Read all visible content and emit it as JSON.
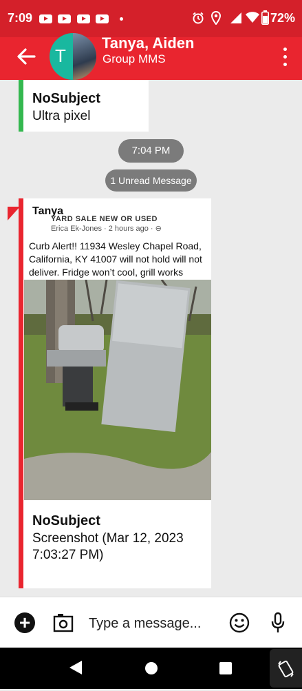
{
  "status_bar": {
    "time": "7:09",
    "battery": "72%",
    "icons": [
      "youtube-icon",
      "youtube-icon",
      "youtube-icon",
      "youtube-icon",
      "dot-icon",
      "alarm-icon",
      "location-icon",
      "signal-icon",
      "wifi-icon",
      "battery-icon"
    ]
  },
  "header": {
    "title": "Tanya, Aiden",
    "subtitle": "Group MMS",
    "avatar_letter": "T",
    "colors": {
      "bar": "#e9252f",
      "status": "#d4202a",
      "avatar": "#19b89f"
    }
  },
  "messages": [
    {
      "subject": "NoSubject",
      "body": "Ultra pixel",
      "accent": "#34b84f"
    },
    {
      "sender": "Tanya",
      "attachment": {
        "cut_heading": "YARD SALE NEW OR USED",
        "author": "Erica Ek-Jones · 2 hours ago · ⊖",
        "text": "Curb Alert!! 11934 Wesley Chapel Road, California, KY 41007 will not hold will not deliver. Fridge won’t cool, grill works"
      },
      "subject": "NoSubject",
      "body_line1": "Screenshot (Mar 12, 2023",
      "body_line2": "7:03:27 PM)",
      "accent": "#e9252f"
    }
  ],
  "time_divider": "7:04 PM",
  "unread_divider": "1 Unread Message",
  "composer": {
    "placeholder": "Type a message..."
  }
}
